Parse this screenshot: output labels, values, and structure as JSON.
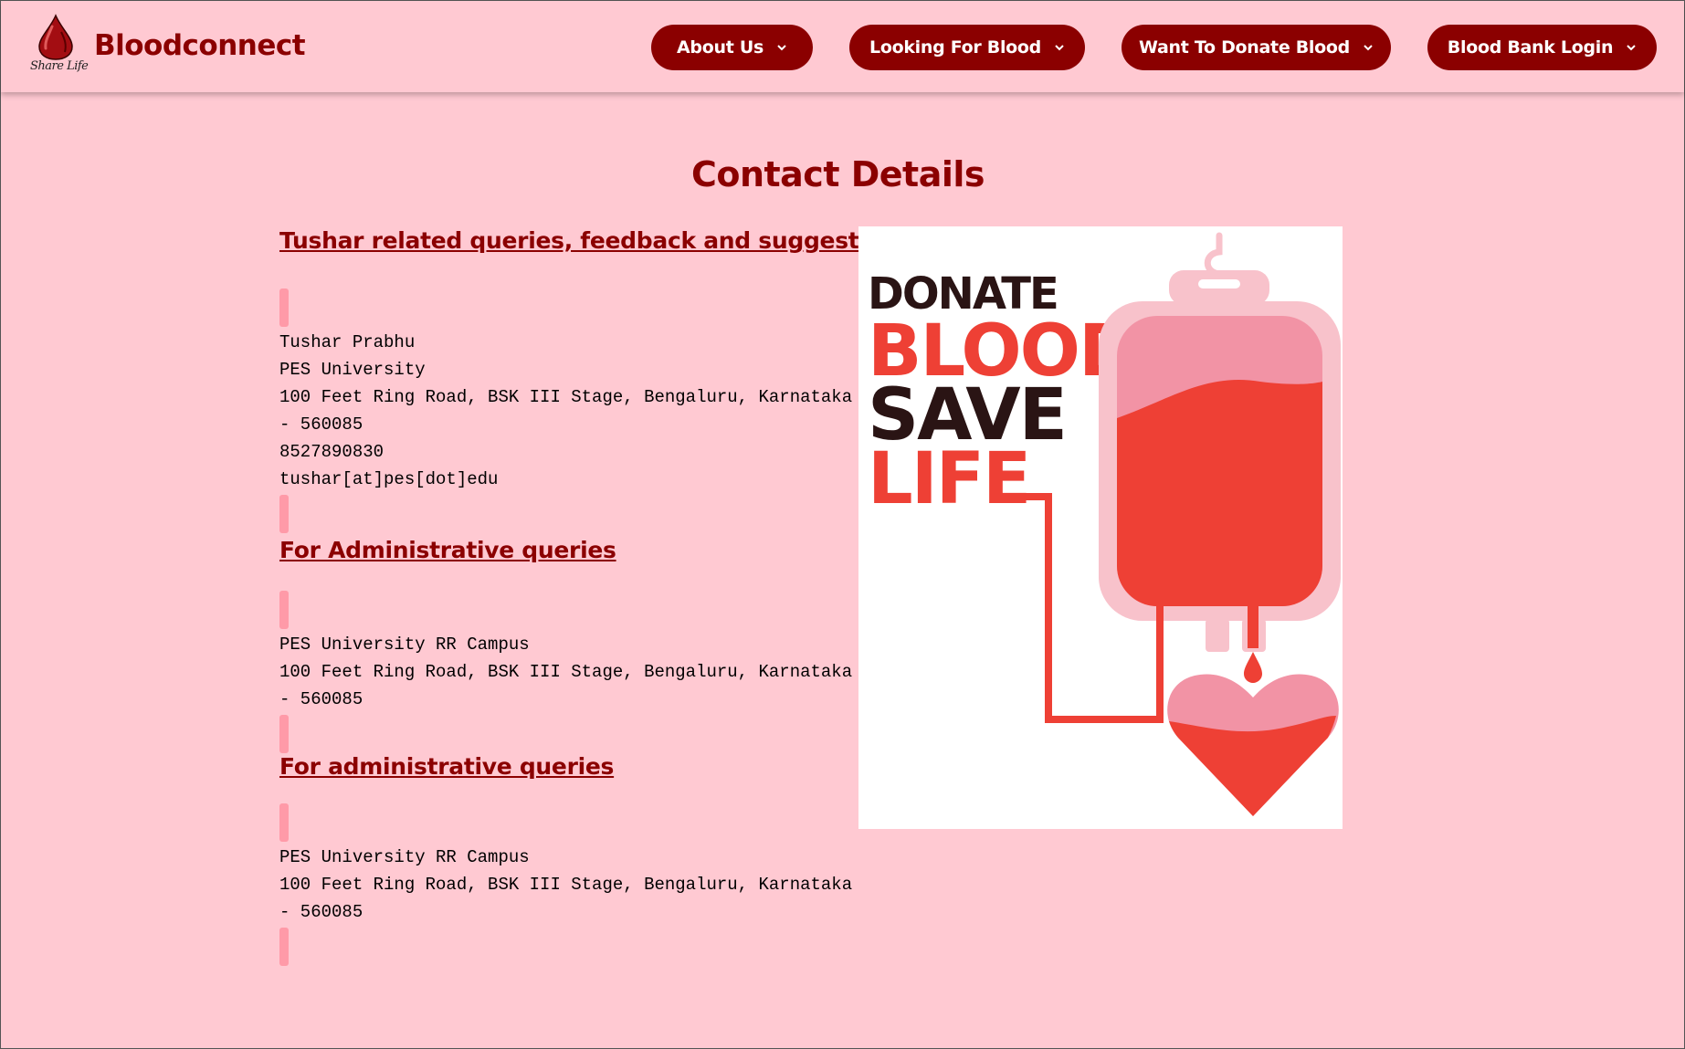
{
  "header": {
    "brand_name": "Bloodconnect",
    "logo_text": "Share Life",
    "nav": [
      {
        "label": "About Us"
      },
      {
        "label": "Looking For Blood"
      },
      {
        "label": "Want To Donate Blood"
      },
      {
        "label": "Blood Bank Login"
      }
    ]
  },
  "page": {
    "title": "Contact Details"
  },
  "contacts": [
    {
      "heading": "Tushar related queries, feedback and suggestions",
      "lines": "Tushar Prabhu\nPES University\n100 Feet Ring Road, BSK III Stage, Bengaluru, Karnataka - 560085\n8527890830\ntushar[at]pes[dot]edu"
    },
    {
      "heading": "For Administrative queries",
      "lines": "PES University RR Campus\n100 Feet Ring Road, BSK III Stage, Bengaluru, Karnataka - 560085"
    },
    {
      "heading": "For administrative queries",
      "lines": "PES University RR Campus\n100 Feet Ring Road, BSK III Stage, Bengaluru, Karnataka - 560085"
    }
  ],
  "poster": {
    "line1": "DONATE",
    "line2": "BLOOD",
    "line3": "SAVE",
    "line4": "LIFE"
  },
  "colors": {
    "background": "#ffc9d2",
    "brand": "#8b0000",
    "accent_bar": "#ff9aa8",
    "blood_red": "#ee4035",
    "bag_pink": "#f8c2cb"
  }
}
